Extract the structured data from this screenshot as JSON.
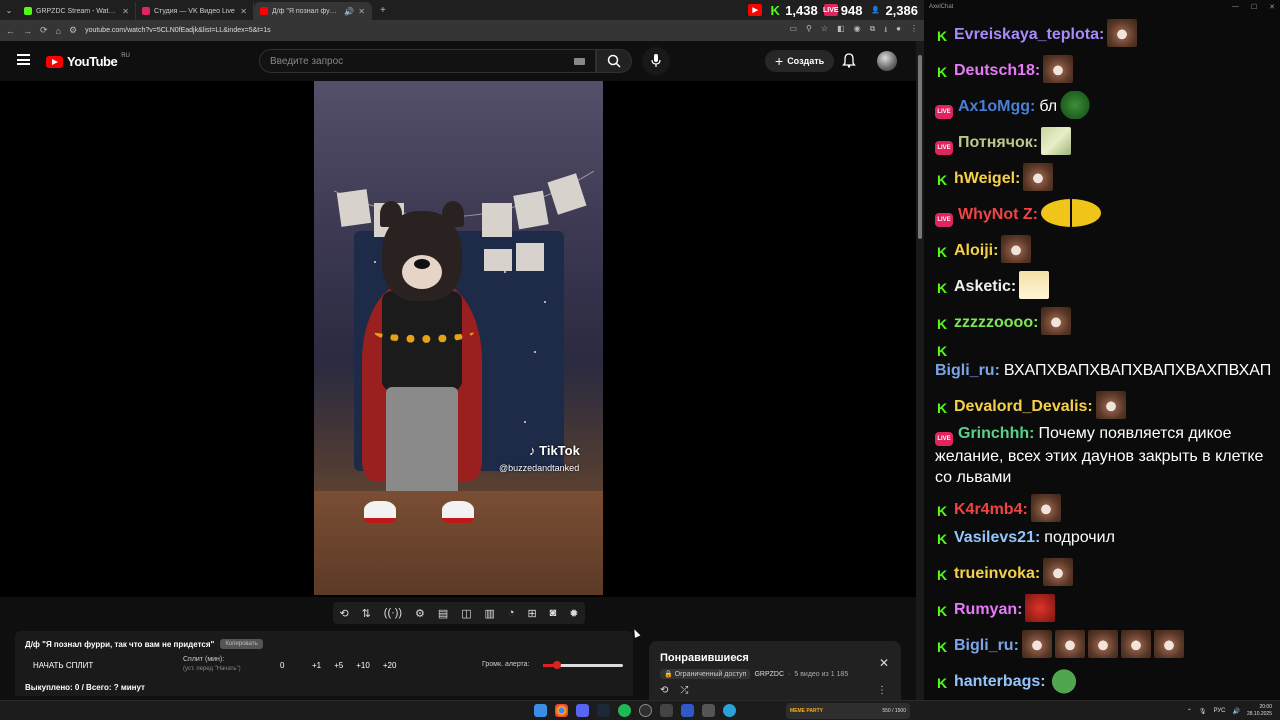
{
  "browser": {
    "tabs": [
      {
        "title": "GRPZDC Stream - Watch Live o",
        "favicon_color": "#53fc18",
        "active": false
      },
      {
        "title": "Студия — VK Видео Live",
        "favicon_color": "#e0245e",
        "active": false
      },
      {
        "title": "Д/ф \"Я познал фурри, так",
        "favicon_color": "#ff0000",
        "active": true
      }
    ],
    "url": "youtube.com/watch?v=5CLN0fEadjk&list=LL&index=5&t=1s"
  },
  "stream_stats": {
    "youtube_viewers": "1,438",
    "vk_viewers": "948",
    "kick_viewers": "2,386"
  },
  "youtube": {
    "logo_text": "YouTube",
    "region": "RU",
    "search_placeholder": "Введите запрос",
    "create_label": "Создать"
  },
  "video": {
    "tiktok_label": "TikTok",
    "tiktok_user": "@buzzedandtanked"
  },
  "split_panel": {
    "title": "Д/ф \"Я познал фурри, так что вам не придется\"",
    "copy_label": "Копировать",
    "start_label": "НАЧАТЬ СПЛИТ",
    "split_label": "Сплит (мин):",
    "split_hint": "(уст. перед \"Начать\")",
    "split_value": "0",
    "buttons": [
      "+1",
      "+5",
      "+10",
      "+20"
    ],
    "alert_label": "Громк. алерта:",
    "alert_volume": 0.18,
    "footer": "Выкуплено: 0 / Всего: ? минут"
  },
  "playlist": {
    "title": "Понравившиеся",
    "access": "Ограниченный доступ",
    "channel": "GRPZDC",
    "position": "5 видео из 1 185"
  },
  "chat": {
    "window_title": "AxelChat",
    "messages": [
      {
        "platform": "kick",
        "user": "Evreiskaya_teplota:",
        "user_color": "#a78bfa",
        "text": "",
        "emotes": [
          "face"
        ]
      },
      {
        "platform": "kick",
        "user": "Deutsch18:",
        "user_color": "#e879f9",
        "text": "",
        "emotes": [
          "face"
        ]
      },
      {
        "platform": "live",
        "user": "Ax1oMgg:",
        "user_color": "#4a7fd6",
        "text": "бл",
        "emotes": [
          "frog"
        ]
      },
      {
        "platform": "live",
        "user": "Потнячок:",
        "user_color": "#b8c98a",
        "text": "",
        "emotes": [
          "grass"
        ]
      },
      {
        "platform": "kick",
        "user": "hWeigel:",
        "user_color": "#f5d04b",
        "text": "",
        "emotes": [
          "face"
        ]
      },
      {
        "platform": "live",
        "user": "WhyNot Z:",
        "user_color": "#ef4444",
        "text": "",
        "emotes": [
          "laugh"
        ]
      },
      {
        "platform": "kick",
        "user": "Aloiji:",
        "user_color": "#f5d04b",
        "text": "",
        "emotes": [
          "face"
        ]
      },
      {
        "platform": "kick",
        "user": "Asketic:",
        "user_color": "#f0f0f0",
        "text": "",
        "emotes": [
          "anime"
        ]
      },
      {
        "platform": "kick",
        "user": "zzzzzoooo:",
        "user_color": "#7ee65a",
        "text": "",
        "emotes": [
          "face"
        ]
      },
      {
        "platform": "kick",
        "user": "Bigli_ru:",
        "user_color": "#7aa5e6",
        "text": "ВХАПХВАПХВАПХВАПХВАХПВХАП",
        "emotes": []
      },
      {
        "platform": "kick",
        "user": "Devalord_Devalis:",
        "user_color": "#f5d04b",
        "text": "",
        "emotes": [
          "face"
        ]
      },
      {
        "platform": "live",
        "user": "Grinchhh:",
        "user_color": "#5ad08a",
        "text": "Почему появляется дикое желание, всех этих даунов закрыть в клетке со львами",
        "emotes": []
      },
      {
        "platform": "kick",
        "user": "K4r4mb4:",
        "user_color": "#ef4444",
        "text": "",
        "emotes": [
          "face"
        ]
      },
      {
        "platform": "kick",
        "user": "Vasilevs21:",
        "user_color": "#93c5fd",
        "text": "подрочил",
        "emotes": []
      },
      {
        "platform": "kick",
        "user": "trueinvoka:",
        "user_color": "#f5d04b",
        "text": "",
        "emotes": [
          "face"
        ]
      },
      {
        "platform": "kick",
        "user": "Rumyan:",
        "user_color": "#e879f9",
        "text": "",
        "emotes": [
          "red"
        ]
      },
      {
        "platform": "kick",
        "user": "Bigli_ru:",
        "user_color": "#7aa5e6",
        "text": "",
        "emotes": [
          "face",
          "face",
          "face",
          "face",
          "face"
        ]
      },
      {
        "platform": "kick",
        "user": "hanterbags:",
        "user_color": "#93c5fd",
        "text": "",
        "emotes": [
          "pepe"
        ]
      }
    ]
  },
  "taskbar": {
    "widget_label": "MEME PARTY",
    "widget_value": "550 / 1500",
    "lang": "РУС",
    "time": "20:00",
    "date": "28.10.2025"
  }
}
